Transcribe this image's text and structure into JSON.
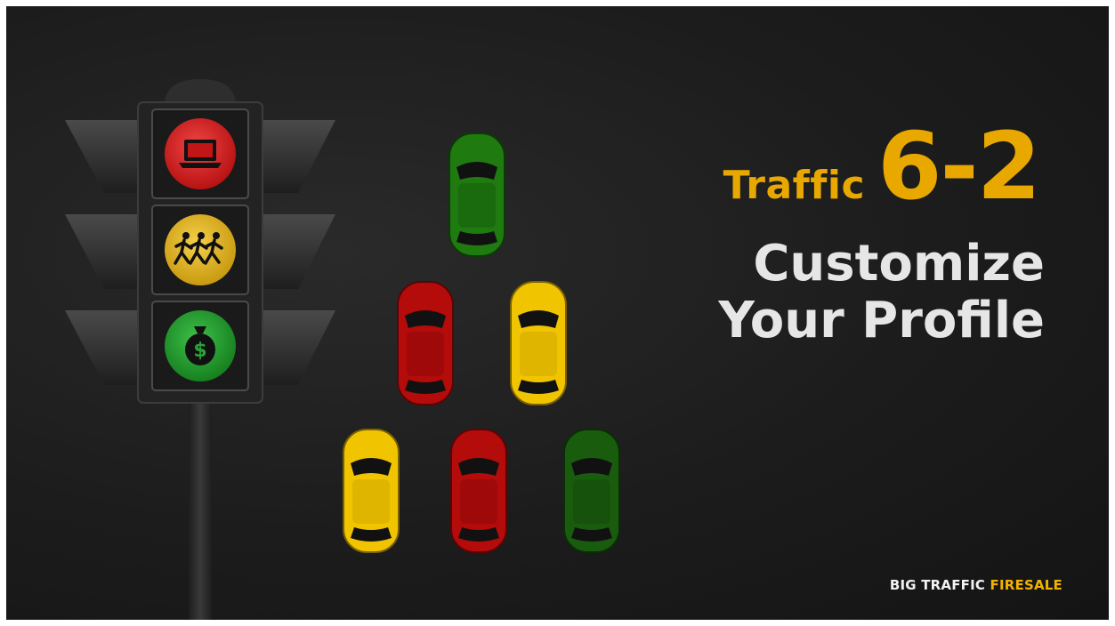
{
  "slide": {
    "title_prefix": "Traffic",
    "title_number": "6-2",
    "subtitle_line1": "Customize",
    "subtitle_line2": "Your Profile"
  },
  "brand": {
    "part1": "BIG TRAFFIC",
    "part2": "FIRESALE"
  },
  "colors": {
    "background": "#1c1c1c",
    "accent_yellow": "#e8a800",
    "text_light": "#e6e6e6",
    "light_red": "#d71f1f",
    "light_yellow": "#e0b525",
    "light_green": "#1f9a2c",
    "car_red": "#b40b0b",
    "car_yellow": "#f1c400",
    "car_green": "#1f7a10",
    "car_dark_green": "#1a5c0e"
  },
  "traffic_light": {
    "lights": [
      {
        "color": "red",
        "icon": "laptop-icon"
      },
      {
        "color": "yellow",
        "icon": "running-people-icon"
      },
      {
        "color": "green",
        "icon": "money-bag-icon"
      }
    ]
  },
  "cars": [
    {
      "color": "green"
    },
    {
      "color": "red"
    },
    {
      "color": "yellow"
    },
    {
      "color": "yellow"
    },
    {
      "color": "red"
    },
    {
      "color": "dark-green"
    }
  ]
}
